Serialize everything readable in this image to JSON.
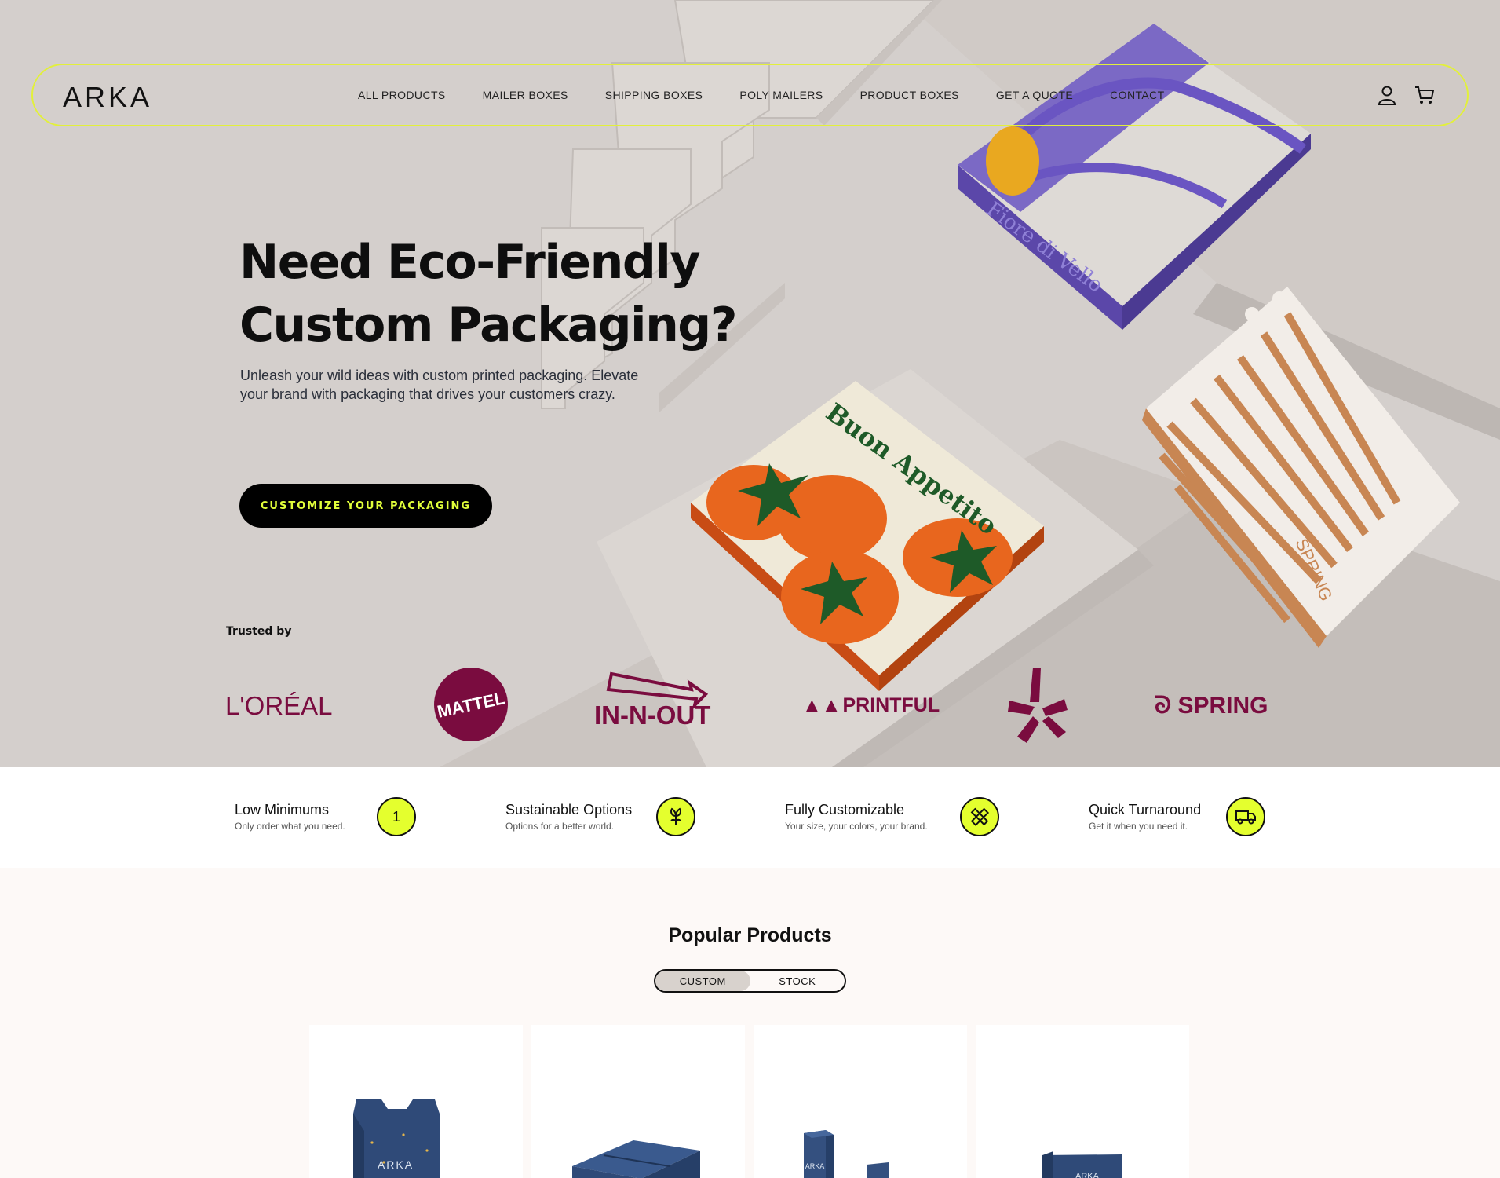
{
  "brand": {
    "logo": "ARKA"
  },
  "nav": {
    "links": [
      "ALL PRODUCTS",
      "MAILER BOXES",
      "SHIPPING BOXES",
      "POLY MAILERS",
      "PRODUCT BOXES",
      "GET A QUOTE",
      "CONTACT"
    ],
    "icons": [
      "user-icon",
      "cart-icon"
    ]
  },
  "hero": {
    "title_line1": "Need Eco-Friendly",
    "title_line2": "Custom Packaging?",
    "subtitle": "Unleash your wild ideas with custom printed packaging. Elevate your brand with packaging that drives your customers crazy.",
    "cta": "CUSTOMIZE YOUR PACKAGING",
    "box_labels": [
      "Buon Appetito",
      "Fiore di Vello",
      "SPRING"
    ]
  },
  "trusted": {
    "label": "Trusted by",
    "logos": [
      "L'ORÉAL",
      "MATTEL",
      "IN-N-OUT BURGER",
      "PRINTFUL",
      "yelp",
      "SPRING"
    ],
    "brand_color": "#7a0c3f"
  },
  "features": [
    {
      "title": "Low Minimums",
      "desc": "Only order what you need.",
      "badge": "1"
    },
    {
      "title": "Sustainable Options",
      "desc": "Options for a better world.",
      "icon": "plant-icon"
    },
    {
      "title": "Fully Customizable",
      "desc": "Your size, your colors, your brand.",
      "icon": "ruler-pencil-icon"
    },
    {
      "title": "Quick Turnaround",
      "desc": "Get it when you need it.",
      "icon": "truck-icon"
    }
  ],
  "products": {
    "title": "Popular Products",
    "tabs": [
      "CUSTOM",
      "STOCK"
    ],
    "active_tab": "CUSTOM",
    "box_print": "ARKA"
  },
  "colors": {
    "accent": "#e4ff2e",
    "hero_bg": "#d4cfcc",
    "brand_logo": "#7a0c3f",
    "cta_bg": "#000000"
  }
}
